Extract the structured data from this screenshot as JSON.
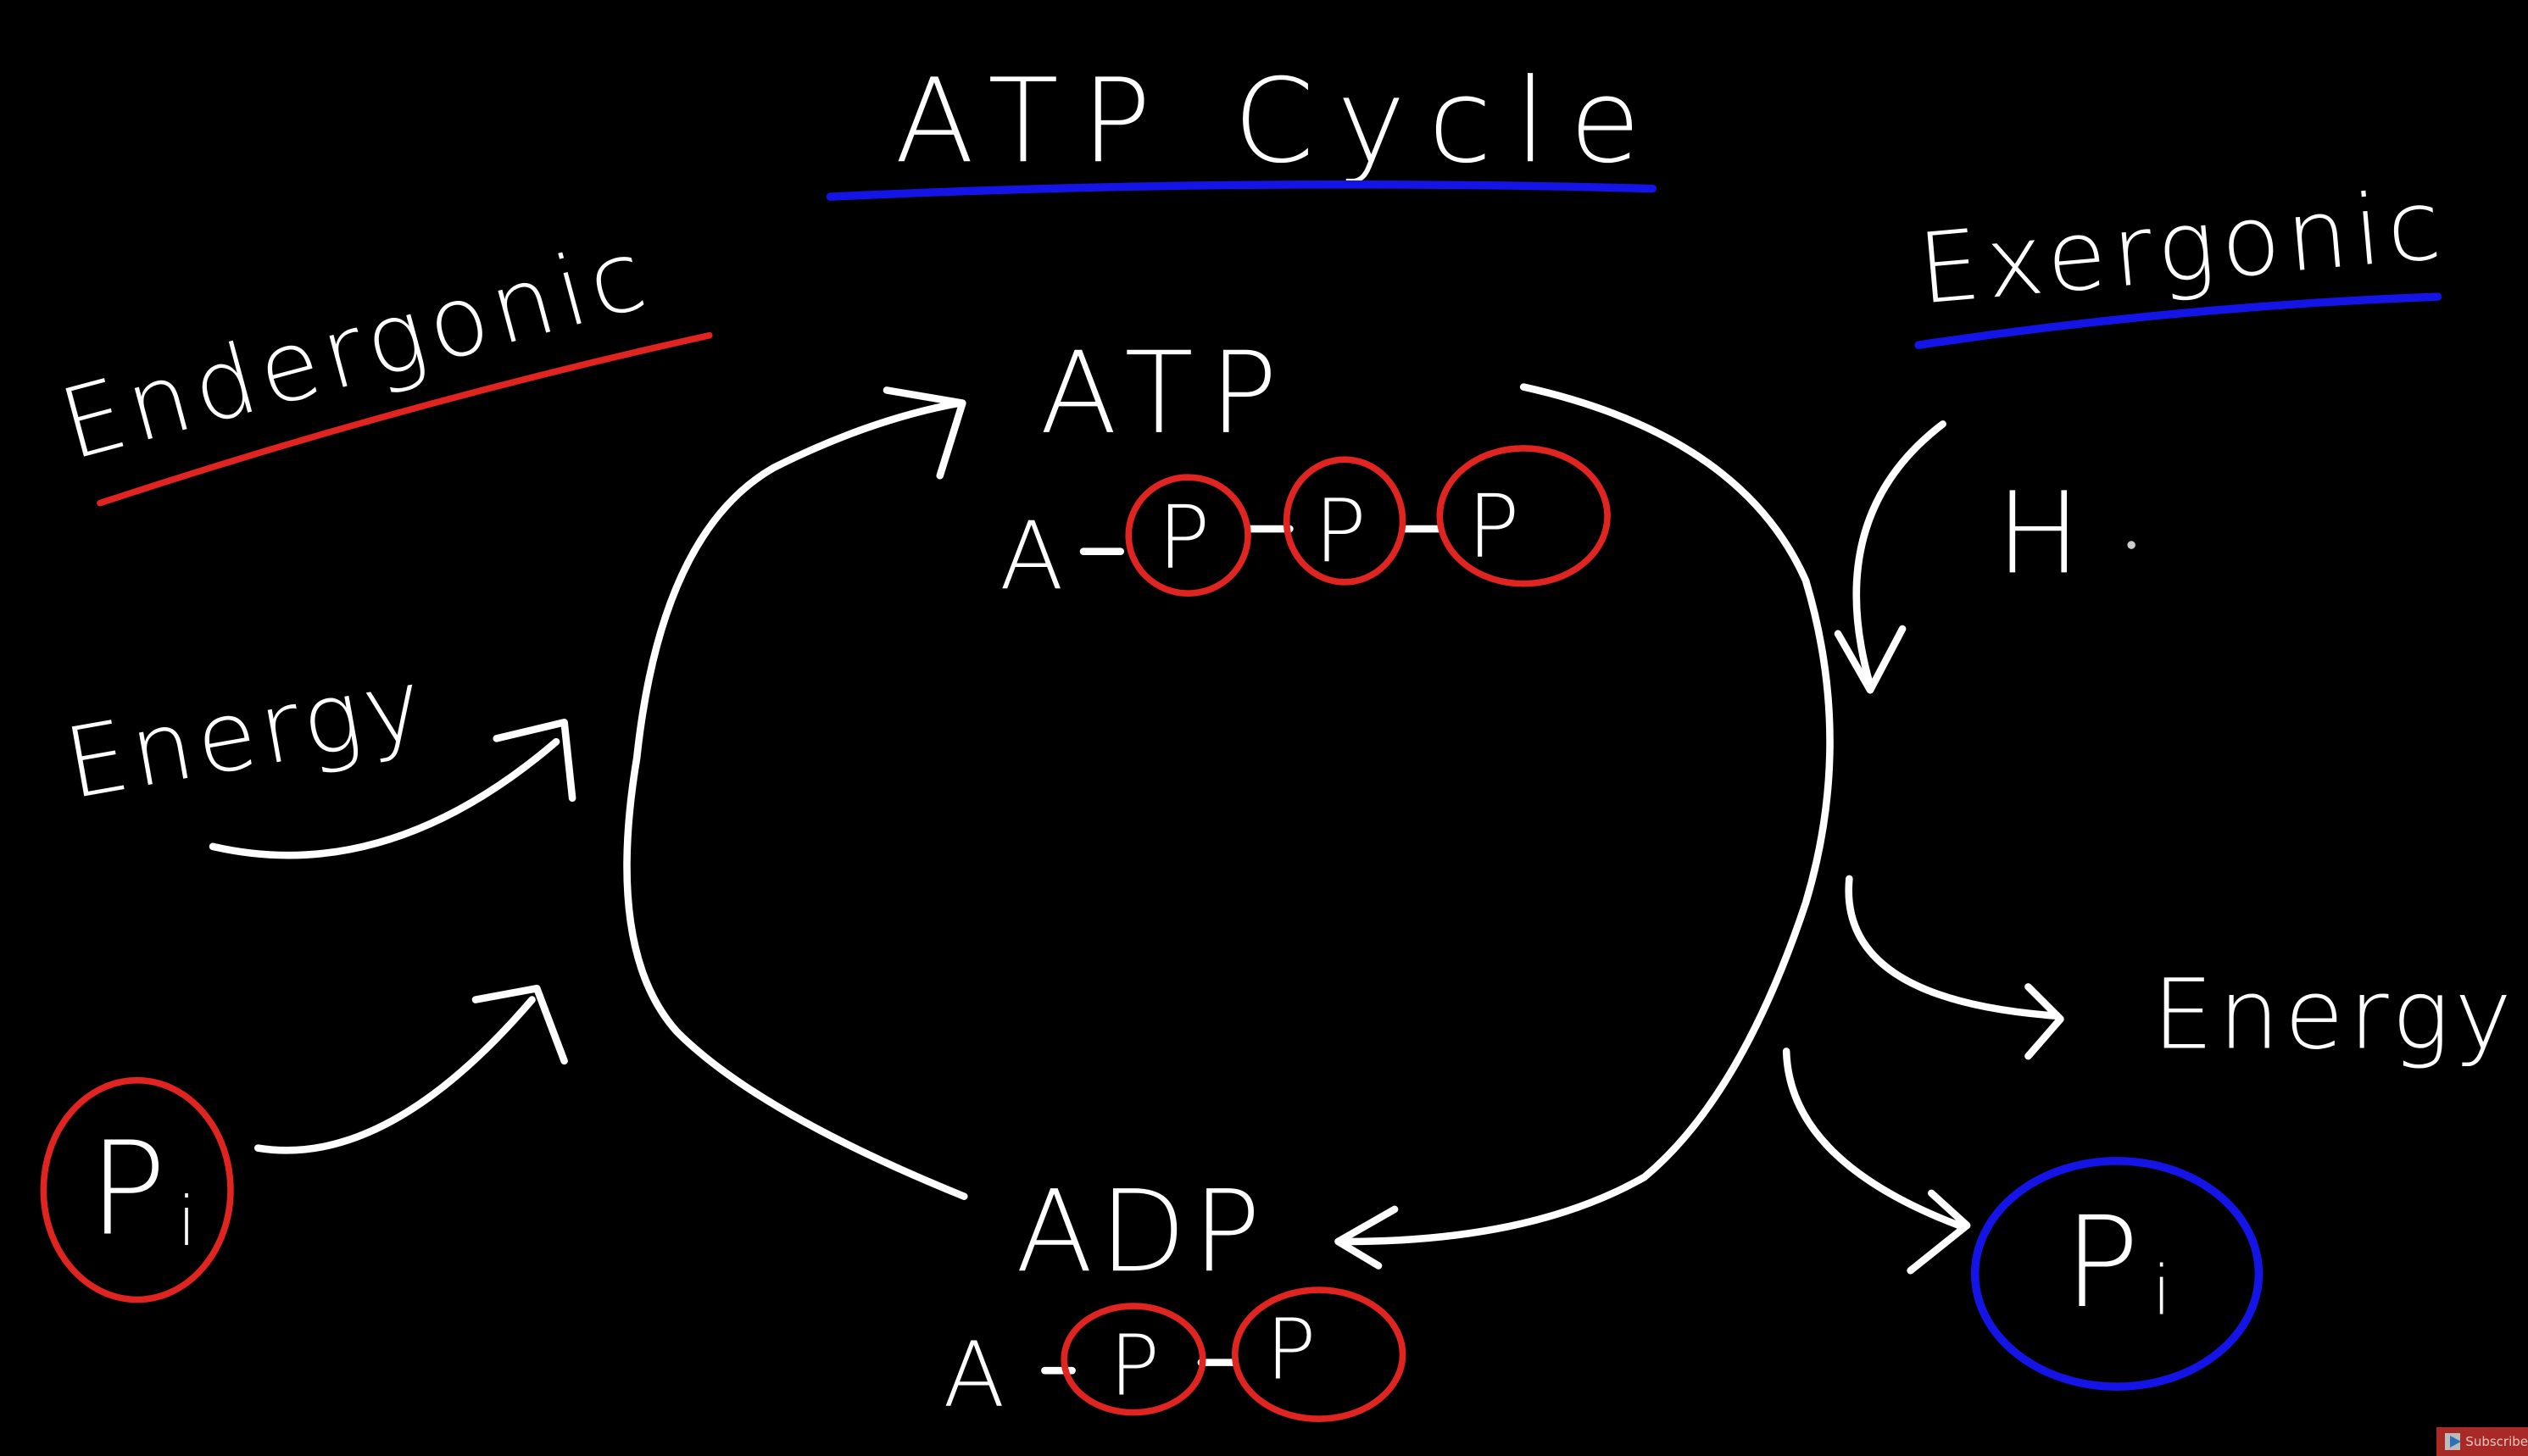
{
  "title": "ATP Cycle",
  "left_label": "Endergonic",
  "right_label": "Exergonic",
  "atp": {
    "label": "ATP",
    "adenosine": "A",
    "phosphates": [
      "P",
      "P",
      "P"
    ]
  },
  "adp": {
    "label": "ADP",
    "adenosine": "A",
    "phosphates": [
      "P",
      "P"
    ]
  },
  "energy_in": "Energy",
  "energy_out": "Energy",
  "pi_in": {
    "p": "P",
    "sub": "i"
  },
  "pi_out": {
    "p": "P",
    "sub": "i"
  },
  "water": "H",
  "colors": {
    "background": "#000000",
    "ink": "#ffffff",
    "red": "#e0241f",
    "blue": "#1414e6"
  },
  "subscribe": {
    "label": "Subscribe",
    "icon": "play-icon"
  }
}
